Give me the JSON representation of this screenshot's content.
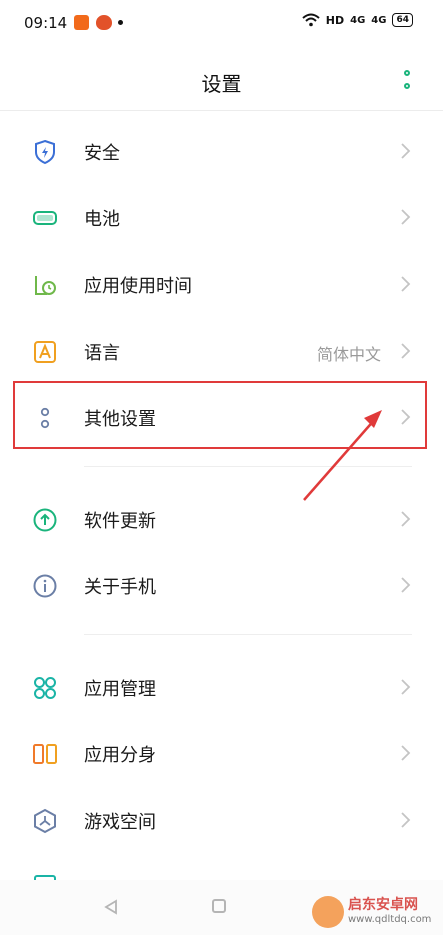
{
  "status": {
    "time": "09:14",
    "network": "HD",
    "signal1": "4G",
    "signal2": "4G",
    "battery": "64"
  },
  "header": {
    "title": "设置"
  },
  "rows": [
    {
      "label": "安全",
      "icon": "shield-icon"
    },
    {
      "label": "电池",
      "icon": "battery-icon"
    },
    {
      "label": "应用使用时间",
      "icon": "timer-icon"
    },
    {
      "label": "语言",
      "value": "简体中文",
      "icon": "language-icon"
    },
    {
      "label": "其他设置",
      "icon": "more-settings-icon"
    },
    {
      "label": "软件更新",
      "icon": "update-icon"
    },
    {
      "label": "关于手机",
      "icon": "info-icon"
    },
    {
      "label": "应用管理",
      "icon": "apps-icon"
    },
    {
      "label": "应用分身",
      "icon": "clone-icon"
    },
    {
      "label": "游戏空间",
      "icon": "game-icon"
    }
  ],
  "watermark": {
    "name": "启东安卓网",
    "url": "www.qdltdq.com"
  },
  "colors": {
    "accent": "#1ab47c",
    "highlight": "#e03a3a",
    "secondary_text": "#9a9a9a"
  }
}
